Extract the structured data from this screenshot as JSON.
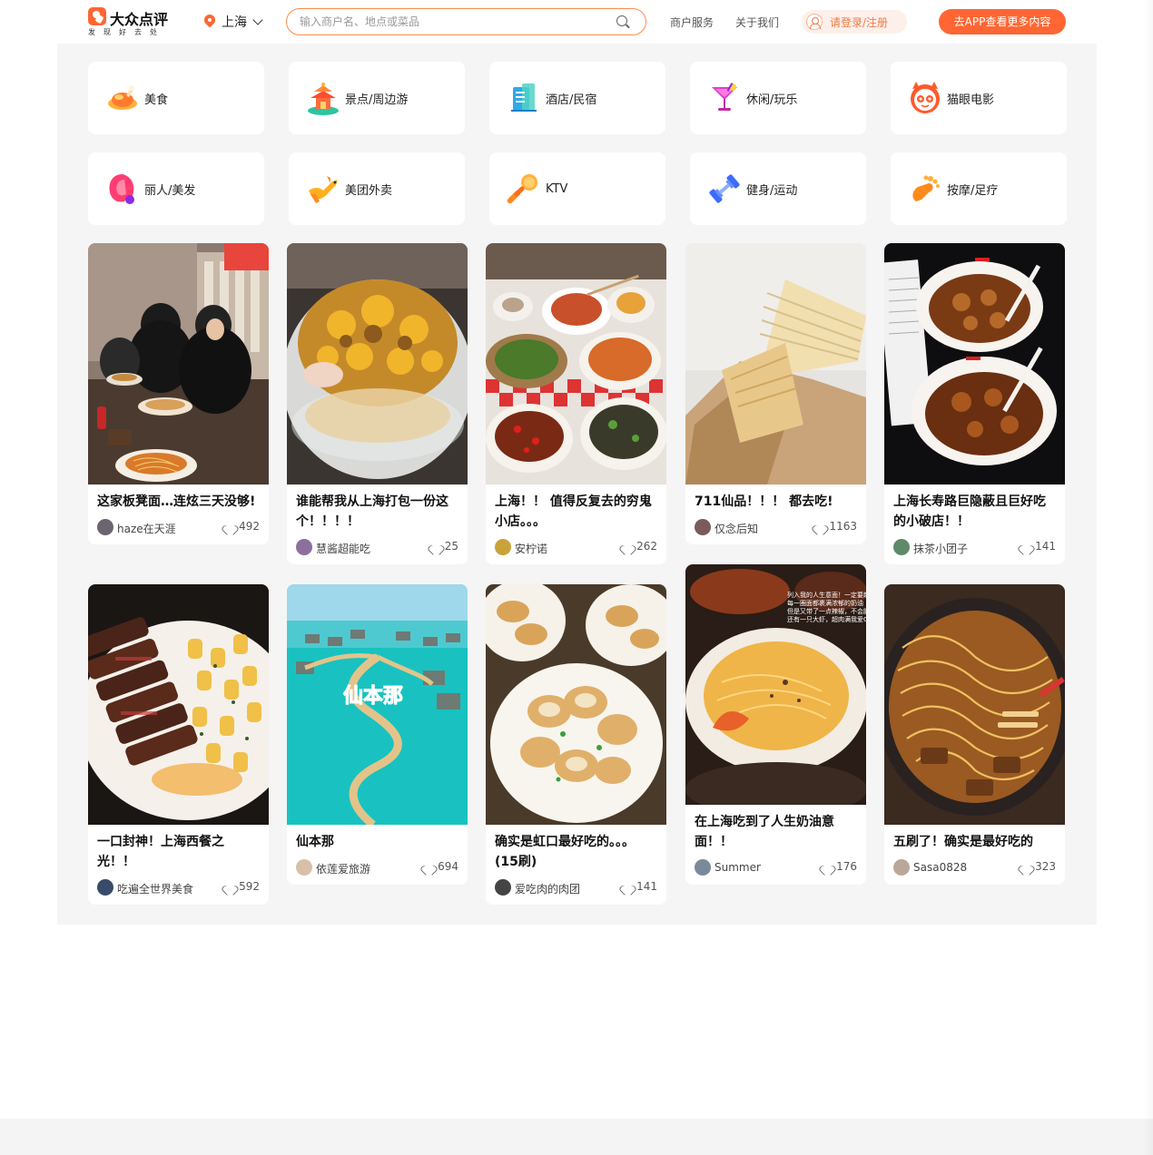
{
  "header": {
    "logo_name": "大众点评",
    "logo_slogan": "发现好去处",
    "city": "上海",
    "search_placeholder": "输入商户名、地点或菜品",
    "nav": [
      "商户服务",
      "关于我们"
    ],
    "login_label": "请登录/注册",
    "app_button": "去APP查看更多内容"
  },
  "colors": {
    "brand": "#ff6633",
    "background": "#f5f5f5"
  },
  "categories": [
    {
      "label": "美食",
      "icon": "roast-chicken-icon"
    },
    {
      "label": "景点/周边游",
      "icon": "pagoda-icon"
    },
    {
      "label": "酒店/民宿",
      "icon": "hotel-building-icon"
    },
    {
      "label": "休闲/玩乐",
      "icon": "cocktail-icon"
    },
    {
      "label": "猫眼电影",
      "icon": "cat-eye-icon"
    },
    {
      "label": "丽人/美发",
      "icon": "beauty-hair-icon"
    },
    {
      "label": "美团外卖",
      "icon": "kangaroo-icon"
    },
    {
      "label": "KTV",
      "icon": "microphone-icon"
    },
    {
      "label": "健身/运动",
      "icon": "dumbbell-icon"
    },
    {
      "label": "按摩/足疗",
      "icon": "foot-icon"
    }
  ],
  "feed": [
    {
      "title": "这家板凳面…连炫三天没够!",
      "user": "haze在天涯",
      "likes": "492",
      "image": "noodle-shop-diners"
    },
    {
      "title": "谁能帮我从上海打包一份这个！！！！",
      "user": "慧酱超能吃",
      "likes": "25",
      "image": "takeout-bowl-food"
    },
    {
      "title": "上海！！ 值得反复去的穷鬼小店。。。",
      "user": "安柠诺",
      "likes": "262",
      "image": "table-of-dishes"
    },
    {
      "title": "711仙品！！！ 都去吃!",
      "user": "仅念后知",
      "likes": "1163",
      "image": "crepe-cake"
    },
    {
      "title": "上海长寿路巨隐蔽且巨好吃的小破店！！",
      "user": "抹茶小团子",
      "likes": "141",
      "image": "beef-stew-bowls"
    },
    {
      "title": "一口封神！上海西餐之光！！",
      "user": "吃遍全世界美食",
      "likes": "592",
      "image": "steak-pasta"
    },
    {
      "title": "仙本那",
      "user": "依莲爱旅游",
      "likes": "694",
      "image": "semporna-water-villas",
      "image_text": "仙本那"
    },
    {
      "title": "确实是虹口最好吃的。。。(15刷)",
      "user": "爱吃肉的肉团",
      "likes": "141",
      "image": "fried-dough-plate"
    },
    {
      "title": "在上海吃到了人生奶油意面！！",
      "user": "Summer",
      "likes": "176",
      "image": "cream-pasta-plate",
      "image_text": "列入我的人生意面！一定要趁热吃！每一圈面都裹满浓郁的奶油 但是又带了一点辣椒，不会腻腻 还有一只大虾，超肉满我爱Q弹"
    },
    {
      "title": "五刷了！确实是最好吃的",
      "user": "Sasa0828",
      "likes": "323",
      "image": "beef-noodle-bowl"
    }
  ]
}
